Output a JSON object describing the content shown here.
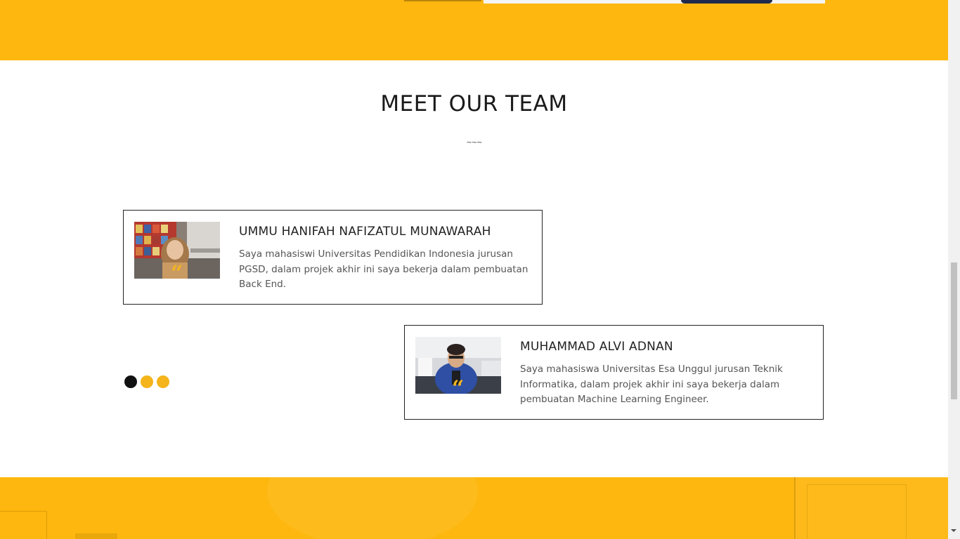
{
  "section": {
    "title": "MEET OUR TEAM",
    "divider": "~~~"
  },
  "team": [
    {
      "name": "UMMU HANIFAH NAFIZATUL MUNAWARAH",
      "bio": "Saya mahasiswi Universitas Pendidikan Indonesia jurusan PGSD, dalam projek akhir ini saya bekerja dalam pembuatan Back End.",
      "quote_glyph": "“"
    },
    {
      "name": "MUHAMMAD ALVI ADNAN",
      "bio": "Saya mahasiswa Universitas Esa Unggul jurusan Teknik Informatika, dalam projek akhir ini saya bekerja dalam pembuatan Machine Learning Engineer.",
      "quote_glyph": "“"
    }
  ],
  "carousel": {
    "page_count": 3,
    "active_page": 1
  },
  "colors": {
    "accent": "#fdb70e",
    "dot_active": "#111111",
    "dot_inactive": "#f4b41a"
  }
}
